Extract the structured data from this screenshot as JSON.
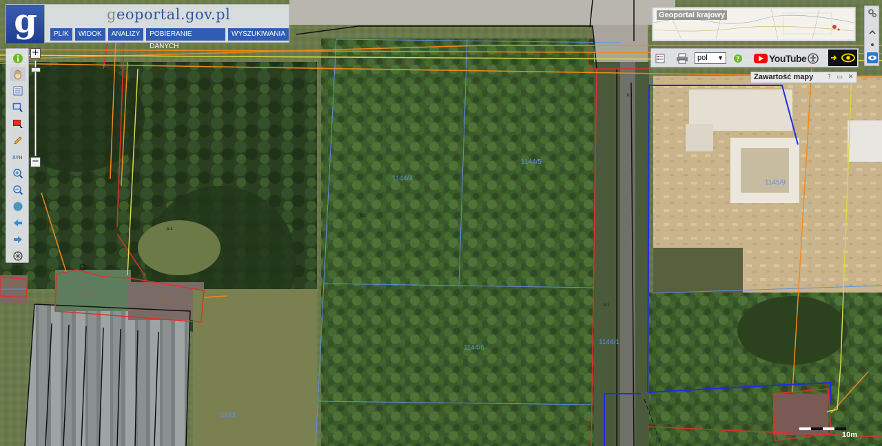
{
  "header": {
    "logo_letter": "g",
    "site_title_prefix": "g",
    "site_title_rest": "eoportal.gov.pl",
    "menu": [
      "PLIK",
      "WIDOK",
      "ANALIZY",
      "POBIERANIE DANYCH",
      "WYSZUKIWANIA"
    ]
  },
  "minimap": {
    "title": "Geoportal krajowy"
  },
  "right_toolbar": {
    "language": "pol",
    "youtube_label": "YouTube"
  },
  "map_contents": {
    "title": "Zawartość mapy"
  },
  "scale": {
    "label": "10m"
  },
  "parcels": [
    "1144/4",
    "1144/5",
    "1144/6",
    "1144/1",
    "1143",
    "1145/9"
  ],
  "building_labels": [
    "m1",
    "m1"
  ],
  "colors": {
    "header_blue": "#2f5db2",
    "parcel_boundary": "#5b90e0",
    "utility_orange": "#f08a1c",
    "utility_yellow": "#d8d848",
    "road_red": "#e0302a",
    "selection_blue": "#1c2de8"
  },
  "tools": [
    "info-icon",
    "pan-hand-icon",
    "layers-icon",
    "select-rectangle-icon",
    "deselect-icon",
    "pencil-icon",
    "xyz-coordinates-icon",
    "zoom-in-icon",
    "zoom-out-icon",
    "globe-icon",
    "back-arrow-icon",
    "forward-arrow-icon",
    "reset-icon"
  ]
}
